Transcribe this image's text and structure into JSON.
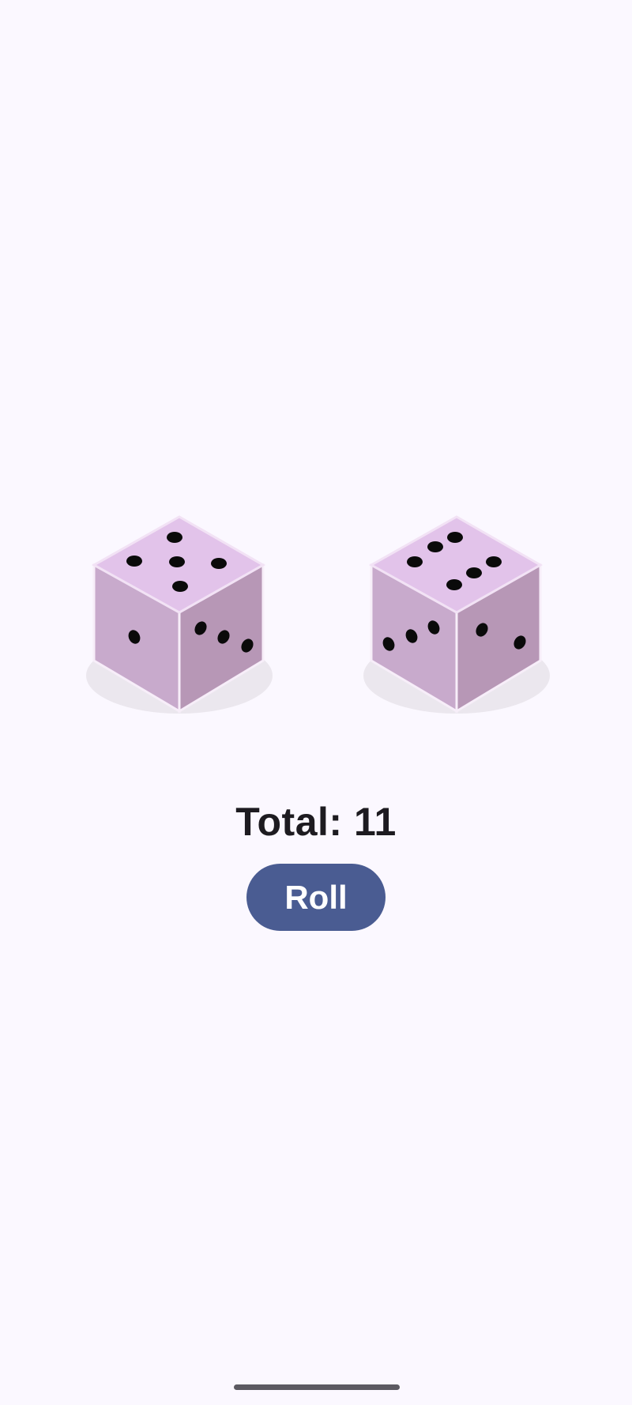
{
  "app": {
    "total_label": "Total: 11",
    "roll_button_label": "Roll"
  },
  "dice": [
    {
      "name": "left-die",
      "top_face": 5,
      "left_face": 1,
      "right_face": 3
    },
    {
      "name": "right-die",
      "top_face": 6,
      "left_face": 3,
      "right_face": 2
    }
  ],
  "colors": {
    "background": "#FBF8FF",
    "die_top": "#E2C4EA",
    "die_left": "#C5A7C8",
    "die_right": "#B898B5",
    "pip": "#0A0A0A",
    "button": "#4A5C92",
    "button_text": "#FFFFFF",
    "text": "#1D1B20"
  }
}
